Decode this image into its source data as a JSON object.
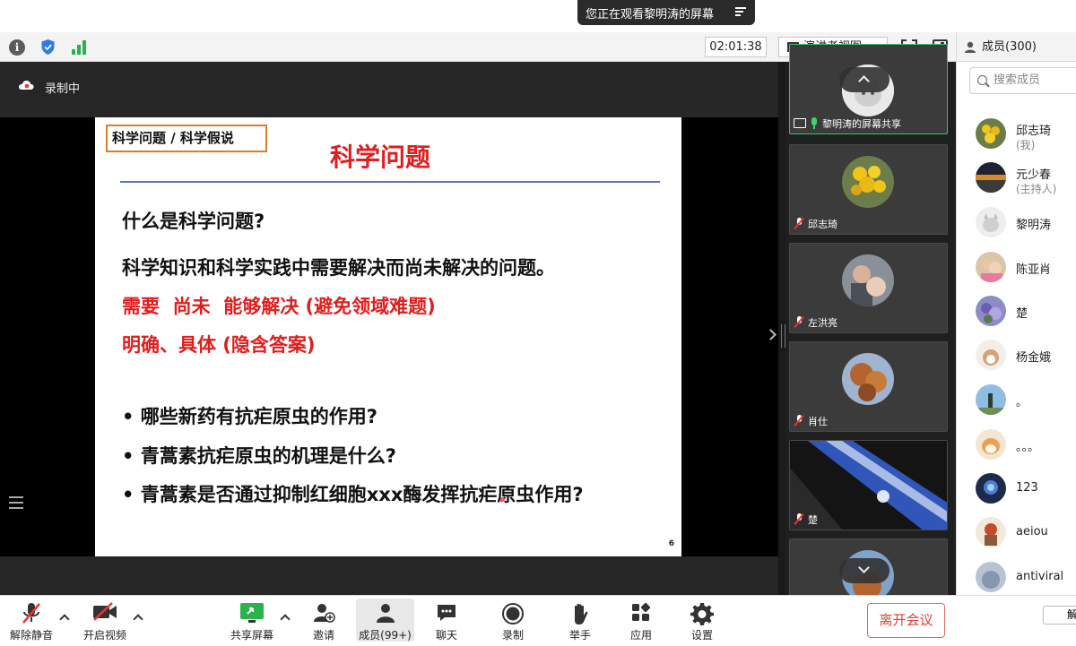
{
  "banner": {
    "text": "您正在观看黎明涛的屏幕"
  },
  "toolbar": {
    "timer": "02:01:38",
    "view_mode": "演讲者视图"
  },
  "recording": {
    "label": "录制中"
  },
  "slide": {
    "tag": "科学问题 / 科学假说",
    "title": "科学问题",
    "question": "什么是科学问题?",
    "definition": "科学知识和科学实践中需要解决而尚未解决的问题。",
    "highlight1": "需要  尚未  能够解决 (避免领域难题)",
    "highlight2": "明确、具体 (隐含答案)",
    "bullets": [
      "• 哪些新药有抗疟原虫的作用?",
      "• 青蒿素抗疟原虫的机理是什么?",
      "• 青蒿素是否通过抑制红细胞xxx酶发挥抗疟原虫作用?"
    ],
    "page": "6"
  },
  "gallery": {
    "tiles": [
      {
        "name": "黎明涛的屏幕共享"
      },
      {
        "name": "邱志琦"
      },
      {
        "name": "左洪亮"
      },
      {
        "name": "肖仕"
      },
      {
        "name": "楚"
      }
    ]
  },
  "panel": {
    "title": "成员(300)",
    "search_placeholder": "搜索成员",
    "members": [
      {
        "name": "邱志琦",
        "role": "(我)"
      },
      {
        "name": "元少春",
        "role": "(主持人)"
      },
      {
        "name": "黎明涛",
        "role": ""
      },
      {
        "name": "陈亚肖",
        "role": ""
      },
      {
        "name": "楚",
        "role": ""
      },
      {
        "name": "杨金娥",
        "role": ""
      },
      {
        "name": "。",
        "role": ""
      },
      {
        "name": "。。。",
        "role": ""
      },
      {
        "name": "123",
        "role": ""
      },
      {
        "name": "aeiou",
        "role": ""
      },
      {
        "name": "antiviral",
        "role": ""
      }
    ],
    "bottom_button": "解"
  },
  "bottom_bar": {
    "mute": "解除静音",
    "video": "开启视频",
    "share": "共享屏幕",
    "invite": "邀请",
    "members": "成员(99+)",
    "chat": "聊天",
    "record": "录制",
    "raise_hand": "举手",
    "apps": "应用",
    "settings": "设置",
    "leave": "离开会议"
  },
  "colors": {
    "accent_red": "#e11d1d",
    "active_green": "#3fbf6a",
    "leave_red": "#e2402e"
  }
}
